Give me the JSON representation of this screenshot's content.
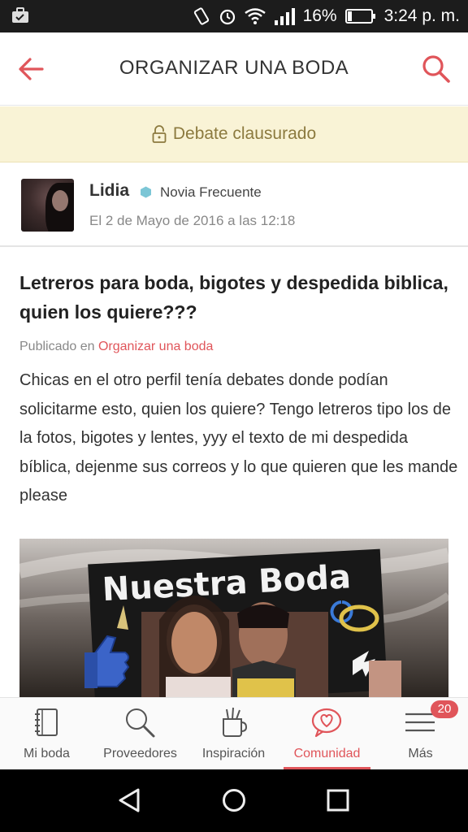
{
  "status_bar": {
    "battery": "16%",
    "time": "3:24 p. m."
  },
  "header": {
    "title": "ORGANIZAR UNA BODA"
  },
  "banner": {
    "text": "Debate clausurado"
  },
  "author": {
    "name": "Lidia",
    "badge": "Novia Frecuente",
    "date": "El 2 de Mayo de 2016 a las 12:18"
  },
  "post": {
    "title": "Letreros para boda, bigotes y despedida biblica, quien los quiere???",
    "published_prefix": "Publicado en",
    "published_link": "Organizar una boda",
    "body": "Chicas en el otro perfil tenía debates donde podían solicitarme esto, quien los quiere? Tengo letreros tipo los de la fotos, bigotes y lentes, yyy el texto de mi despedida bíblica, dejenme sus correos y lo que quieren que les mande please"
  },
  "photo": {
    "sign_text": "Nuestra Boda"
  },
  "bottom_nav": {
    "items": [
      {
        "label": "Mi boda",
        "icon": "notebook-icon"
      },
      {
        "label": "Proveedores",
        "icon": "magnifier-icon"
      },
      {
        "label": "Inspiración",
        "icon": "pencil-cup-icon"
      },
      {
        "label": "Comunidad",
        "icon": "heart-bubble-icon",
        "active": true
      },
      {
        "label": "Más",
        "icon": "menu-icon",
        "badge": "20"
      }
    ]
  },
  "colors": {
    "accent": "#e0555a",
    "banner_bg": "#f9f3d6",
    "banner_text": "#8c7a3f"
  }
}
